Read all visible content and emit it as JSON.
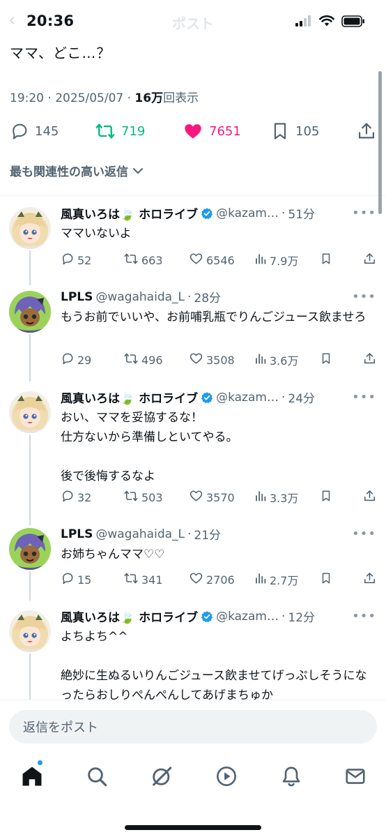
{
  "status_bar": {
    "time": "20:36",
    "header_title": "ポスト",
    "icons": [
      "signal-icon",
      "wifi-icon",
      "battery-icon"
    ]
  },
  "post": {
    "text": "ママ、どこ…？",
    "time": "19:20",
    "date": "2025/05/07",
    "views_count": "16万",
    "views_label": "回表示",
    "replies": "145",
    "reposts": "719",
    "likes": "7651",
    "bookmarks": "105"
  },
  "sort": {
    "label": "最も関連性の高い返信"
  },
  "replies": [
    {
      "name": "風真いろは🍃 ホロライブ",
      "verified": true,
      "handle": "@kazam…",
      "time": "51分",
      "text": "ママいないよ",
      "replies": "52",
      "reposts": "663",
      "likes": "6546",
      "views": "7.9万",
      "avatar": "iroha"
    },
    {
      "name": "LPLS",
      "verified": false,
      "handle": "@wagahaida_L",
      "time": "28分",
      "text": "もうお前でいいや、お前哺乳瓶でりんごジュース飲ませろ",
      "replies": "29",
      "reposts": "496",
      "likes": "3508",
      "views": "3.6万",
      "avatar": "lpls"
    },
    {
      "name": "風真いろは🍃 ホロライブ",
      "verified": true,
      "handle": "@kazam…",
      "time": "24分",
      "text": "おい、ママを妥協するな！\n仕方ないから準備しといてやる。\n\n後で後悔するなよ",
      "replies": "32",
      "reposts": "503",
      "likes": "3570",
      "views": "3.3万",
      "avatar": "iroha"
    },
    {
      "name": "LPLS",
      "verified": false,
      "handle": "@wagahaida_L",
      "time": "21分",
      "text": "お姉ちゃんママ♡♡",
      "replies": "15",
      "reposts": "341",
      "likes": "2706",
      "views": "2.7万",
      "avatar": "lpls"
    },
    {
      "name": "風真いろは🍃 ホロライブ",
      "verified": true,
      "handle": "@kazam…",
      "time": "12分",
      "text": "よちよち^^\n\n絶妙に生ぬるいりんごジュース飲ませてげっぷしそうになったらおしりぺんぺんしてあげまちゅか",
      "replies": "",
      "reposts": "",
      "likes": "",
      "views": "",
      "avatar": "iroha"
    }
  ],
  "reply_box": {
    "placeholder": "返信をポスト"
  },
  "tab_bar": {
    "tabs": [
      "home-icon",
      "search-icon",
      "grok-icon",
      "video-icon",
      "notifications-icon",
      "messages-icon"
    ],
    "badge_color": "#1d9bf0"
  },
  "colors": {
    "repost_green": "#00ba7c",
    "like_pink": "#f91880",
    "verified_blue": "#1d9bf0",
    "secondary_text": "#536471"
  }
}
